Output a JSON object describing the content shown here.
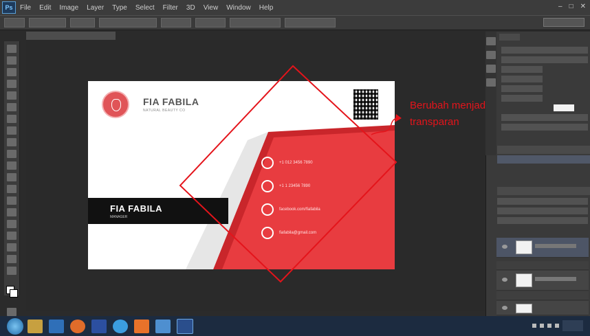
{
  "menubar": {
    "app_icon": "Ps",
    "items": [
      "File",
      "Edit",
      "Image",
      "Layer",
      "Type",
      "Select",
      "Filter",
      "3D",
      "View",
      "Window",
      "Help"
    ]
  },
  "card": {
    "company_name": "FIA FABILA",
    "company_tagline": "NATURAL BEAUTY CO",
    "person_name": "FIA FABILA",
    "person_title": "MANAGER",
    "contacts": [
      {
        "icon": "phone-icon",
        "text": "+1 012 3456 7890"
      },
      {
        "icon": "home-icon",
        "text": "+1 1 23456 7890"
      },
      {
        "icon": "facebook-icon",
        "text": "facebook.com/fiafabila"
      },
      {
        "icon": "mail-icon",
        "text": "fiafabila@gmail.com"
      }
    ]
  },
  "annotation": {
    "line1": "Berubah menjadi",
    "line2": "transparan",
    "color": "#e4141b"
  },
  "colors": {
    "accent_red": "#e83c40",
    "dark_red": "#c9262b",
    "card_black": "#111111"
  }
}
